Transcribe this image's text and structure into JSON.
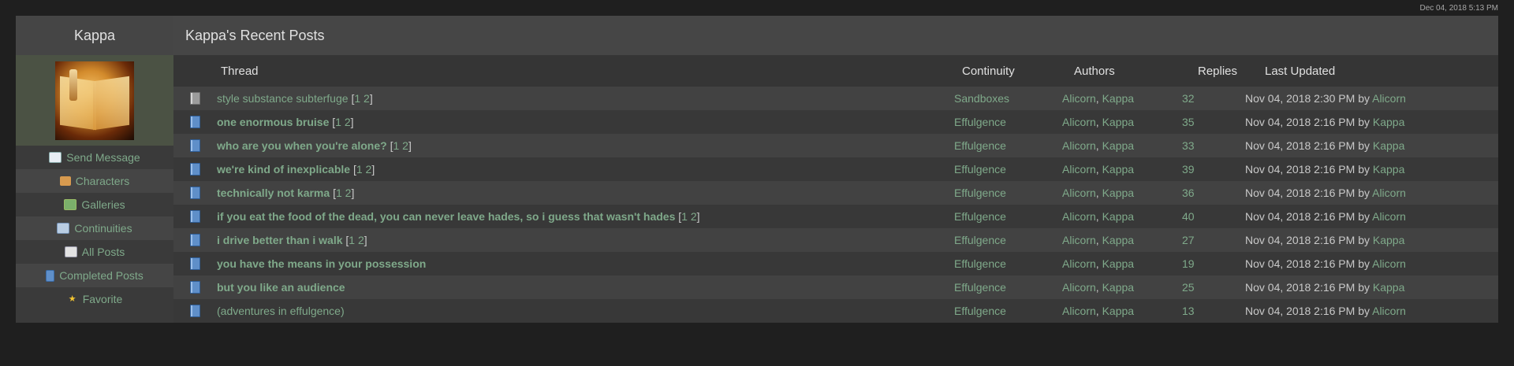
{
  "timestamp": "Dec 04, 2018 5:13 PM",
  "sidebar": {
    "username": "Kappa",
    "items": [
      {
        "label": "Send Message",
        "icon": "mail-icon"
      },
      {
        "label": "Characters",
        "icon": "characters-icon"
      },
      {
        "label": "Galleries",
        "icon": "galleries-icon"
      },
      {
        "label": "Continuities",
        "icon": "continuities-icon"
      },
      {
        "label": "All Posts",
        "icon": "book-icon"
      },
      {
        "label": "Completed Posts",
        "icon": "post-icon"
      },
      {
        "label": "Favorite",
        "icon": "star-icon"
      }
    ]
  },
  "main": {
    "title": "Kappa's Recent Posts",
    "columns": [
      "Thread",
      "Continuity",
      "Authors",
      "Replies",
      "Last Updated"
    ],
    "rows": [
      {
        "thread": "style substance subterfuge",
        "bold": false,
        "pages": [
          "1",
          "2"
        ],
        "continuity": "Sandboxes",
        "authors": [
          "Alicorn",
          "Kappa"
        ],
        "replies": "32",
        "updated": "Nov 04, 2018 2:30 PM",
        "by": "Alicorn",
        "icon_color": "gray"
      },
      {
        "thread": "one enormous bruise",
        "bold": true,
        "pages": [
          "1",
          "2"
        ],
        "continuity": "Effulgence",
        "authors": [
          "Alicorn",
          "Kappa"
        ],
        "replies": "35",
        "updated": "Nov 04, 2018 2:16 PM",
        "by": "Kappa",
        "icon_color": "blue"
      },
      {
        "thread": "who are you when you're alone?",
        "bold": true,
        "pages": [
          "1",
          "2"
        ],
        "continuity": "Effulgence",
        "authors": [
          "Alicorn",
          "Kappa"
        ],
        "replies": "33",
        "updated": "Nov 04, 2018 2:16 PM",
        "by": "Kappa",
        "icon_color": "blue"
      },
      {
        "thread": "we're kind of inexplicable",
        "bold": true,
        "pages": [
          "1",
          "2"
        ],
        "continuity": "Effulgence",
        "authors": [
          "Alicorn",
          "Kappa"
        ],
        "replies": "39",
        "updated": "Nov 04, 2018 2:16 PM",
        "by": "Kappa",
        "icon_color": "blue"
      },
      {
        "thread": "technically not karma",
        "bold": true,
        "pages": [
          "1",
          "2"
        ],
        "continuity": "Effulgence",
        "authors": [
          "Alicorn",
          "Kappa"
        ],
        "replies": "36",
        "updated": "Nov 04, 2018 2:16 PM",
        "by": "Alicorn",
        "icon_color": "blue"
      },
      {
        "thread": "if you eat the food of the dead, you can never leave hades, so i guess that wasn't hades",
        "bold": true,
        "pages": [
          "1",
          "2"
        ],
        "continuity": "Effulgence",
        "authors": [
          "Alicorn",
          "Kappa"
        ],
        "replies": "40",
        "updated": "Nov 04, 2018 2:16 PM",
        "by": "Alicorn",
        "icon_color": "blue"
      },
      {
        "thread": "i drive better than i walk",
        "bold": true,
        "pages": [
          "1",
          "2"
        ],
        "continuity": "Effulgence",
        "authors": [
          "Alicorn",
          "Kappa"
        ],
        "replies": "27",
        "updated": "Nov 04, 2018 2:16 PM",
        "by": "Kappa",
        "icon_color": "blue"
      },
      {
        "thread": "you have the means in your possession",
        "bold": true,
        "pages": [],
        "continuity": "Effulgence",
        "authors": [
          "Alicorn",
          "Kappa"
        ],
        "replies": "19",
        "updated": "Nov 04, 2018 2:16 PM",
        "by": "Alicorn",
        "icon_color": "blue"
      },
      {
        "thread": "but you like an audience",
        "bold": true,
        "pages": [],
        "continuity": "Effulgence",
        "authors": [
          "Alicorn",
          "Kappa"
        ],
        "replies": "25",
        "updated": "Nov 04, 2018 2:16 PM",
        "by": "Kappa",
        "icon_color": "blue"
      },
      {
        "thread": "(adventures in effulgence)",
        "bold": false,
        "pages": [],
        "continuity": "Effulgence",
        "authors": [
          "Alicorn",
          "Kappa"
        ],
        "replies": "13",
        "updated": "Nov 04, 2018 2:16 PM",
        "by": "Alicorn",
        "icon_color": "blue"
      }
    ]
  },
  "colors": {
    "link": "#7fa98a",
    "background": "#1f1f1f",
    "panel": "#3b3b3b"
  }
}
